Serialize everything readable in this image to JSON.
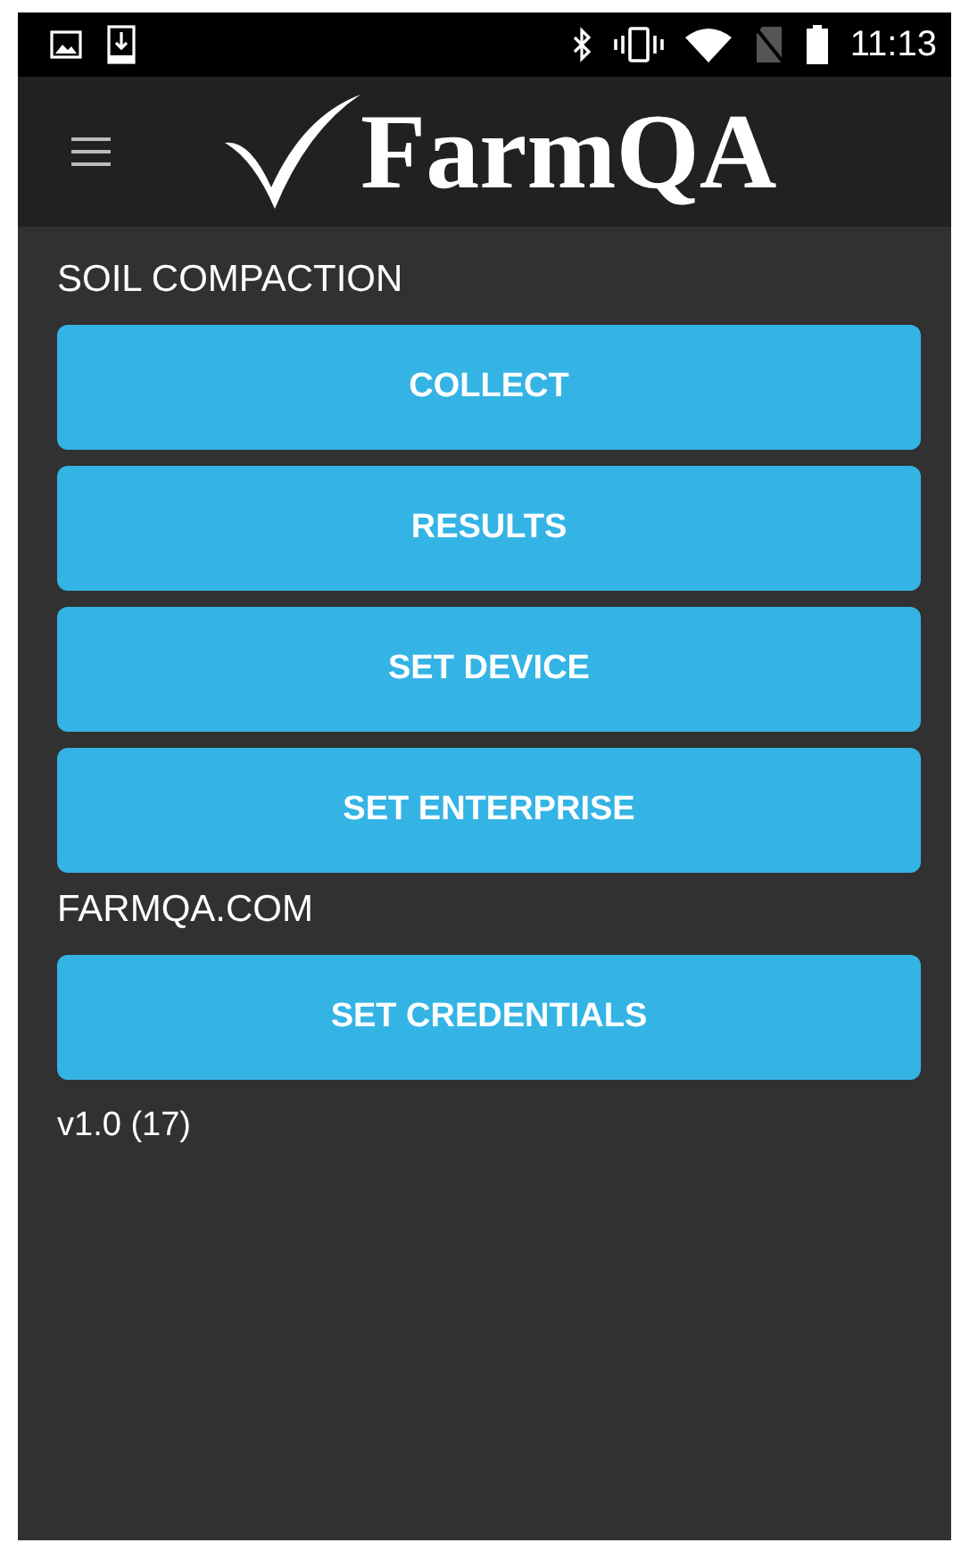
{
  "status_bar": {
    "time": "11:13"
  },
  "app_bar": {
    "title": "FarmQA"
  },
  "sections": [
    {
      "heading": "SOIL COMPACTION",
      "buttons": [
        "COLLECT",
        "RESULTS",
        "SET DEVICE",
        "SET ENTERPRISE"
      ]
    },
    {
      "heading": "FARMQA.COM",
      "buttons": [
        "SET CREDENTIALS"
      ]
    }
  ],
  "version": "v1.0 (17)"
}
